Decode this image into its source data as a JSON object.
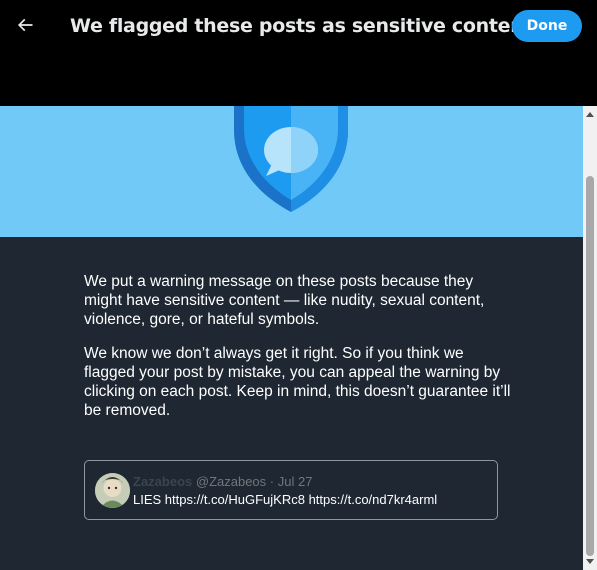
{
  "header": {
    "title": "We flagged these posts as sensitive content",
    "back_icon": "arrow-left-icon",
    "done_label": "Done"
  },
  "banner": {
    "icon": "shield-message-icon",
    "bg_color": "#71c9f8"
  },
  "body": {
    "paragraph1": "We put a warning message on these posts because they might have sensitive content — like nudity, sexual content, violence, gore, or hateful symbols.",
    "paragraph2": "We know we don’t always get it right. So if you think we flagged your post by mistake, you can appeal the warning by clicking on each post. Keep in mind, this doesn’t guarantee it’ll be removed."
  },
  "post": {
    "display_name": "Zazabeos",
    "handle": "@Zazabeos",
    "separator": "·",
    "date": "Jul 27",
    "text": "LIES https://t.co/HuGFujKRc8 https://t.co/nd7kr4arml"
  },
  "colors": {
    "accent": "#1d9bf0",
    "content_bg": "#1e2732"
  }
}
